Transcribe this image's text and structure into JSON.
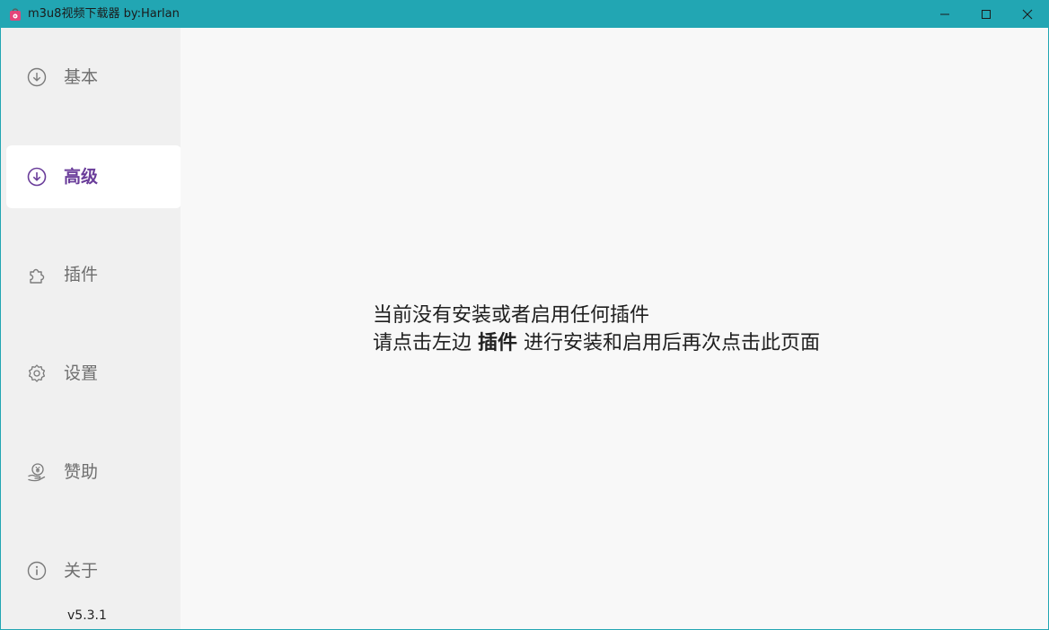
{
  "window": {
    "title": "m3u8视频下载器 by:Harlan",
    "controls": {
      "minimize": "minimize-icon",
      "maximize": "maximize-icon",
      "close": "close-icon"
    }
  },
  "sidebar": {
    "items": [
      {
        "label": "基本",
        "icon": "download-circle-icon",
        "active": false
      },
      {
        "label": "高级",
        "icon": "download-circle-icon",
        "active": true
      },
      {
        "label": "插件",
        "icon": "puzzle-icon",
        "active": false
      },
      {
        "label": "设置",
        "icon": "gear-icon",
        "active": false
      },
      {
        "label": "赞助",
        "icon": "donate-icon",
        "active": false
      },
      {
        "label": "关于",
        "icon": "info-icon",
        "active": false
      }
    ],
    "version": "v5.3.1"
  },
  "main": {
    "line1": "当前没有安装或者启用任何插件",
    "line2_prefix": "请点击左边 ",
    "line2_emphasis": "插件",
    "line2_suffix": " 进行安装和启用后再次点击此页面"
  },
  "colors": {
    "titlebar": "#22a6b3",
    "active_accent": "#6a3d9a",
    "sidebar_bg": "#f0f0f0",
    "main_bg": "#f8f8f8"
  }
}
